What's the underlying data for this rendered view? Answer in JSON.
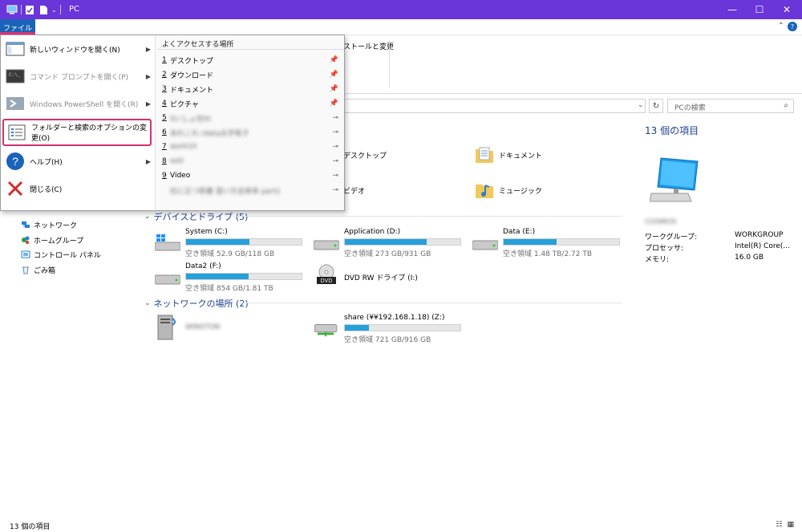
{
  "window": {
    "title": "PC",
    "minimize": "—",
    "maximize": "☐",
    "close": "✕"
  },
  "tabs": {
    "file": "ファイル",
    "help": "?",
    "collapse": "⌃"
  },
  "ribbon": {
    "partial_label": "ストールと変更"
  },
  "address": {
    "search_placeholder": "PCの検索",
    "refresh": "↻",
    "search_icon": "⌕"
  },
  "nav": {
    "items": [
      {
        "label": "ネットワーク",
        "icon": "network-icon"
      },
      {
        "label": "ホームグループ",
        "icon": "homegroup-icon"
      },
      {
        "label": "コントロール パネル",
        "icon": "control-panel-icon"
      },
      {
        "label": "ごみ箱",
        "icon": "recycle-bin-icon"
      }
    ]
  },
  "folders": [
    {
      "label": "デスクトップ",
      "icon": "desktop-folder-icon"
    },
    {
      "label": "ドキュメント",
      "icon": "documents-folder-icon"
    },
    {
      "label": "ビデオ",
      "icon": "videos-folder-icon"
    },
    {
      "label": "ミュージック",
      "icon": "music-folder-icon"
    }
  ],
  "groups": {
    "devices": "デバイスとドライブ (5)",
    "network": "ネットワークの場所 (2)"
  },
  "drives": [
    {
      "name": "System (C:)",
      "free": "空き領域 52.9 GB/118 GB",
      "used_fraction": 0.55
    },
    {
      "name": "Application (D:)",
      "free": "空き領域 273 GB/931 GB",
      "used_fraction": 0.71
    },
    {
      "name": "Data (E:)",
      "free": "空き領域 1.48 TB/2.72 TB",
      "used_fraction": 0.46
    },
    {
      "name": "Data2 (F:)",
      "free": "空き領域 854 GB/1.81 TB",
      "used_fraction": 0.54
    },
    {
      "name": "DVD RW ドライブ (I:)",
      "free": "",
      "used_fraction": 0
    }
  ],
  "network_locations": [
    {
      "name": "WINSTON",
      "free": ""
    },
    {
      "name": "share (¥¥192.168.1.18) (Z:)",
      "free": "空き領域 721 GB/916 GB",
      "used_fraction": 0.21
    }
  ],
  "details": {
    "title": "13 個の項目",
    "computer_name": "COSMOS",
    "props": [
      {
        "key": "ワークグループ:",
        "value": "WORKGROUP"
      },
      {
        "key": "プロセッサ:",
        "value": "Intel(R) Core(..."
      },
      {
        "key": "メモリ:",
        "value": "16.0 GB"
      }
    ]
  },
  "file_menu": {
    "items": [
      {
        "label": "新しいウィンドウを開く(N)",
        "icon": "new-window-icon",
        "arrow": true,
        "disabled": false
      },
      {
        "label": "コマンド プロンプトを開く(P)",
        "icon": "command-prompt-icon",
        "arrow": true,
        "disabled": true
      },
      {
        "label": "Windows PowerShell を開く(R)",
        "icon": "powershell-icon",
        "arrow": true,
        "disabled": true
      },
      {
        "label": "フォルダーと検索のオプションの変更(O)",
        "icon": "folder-options-icon",
        "arrow": false,
        "disabled": false
      },
      {
        "label": "ヘルプ(H)",
        "icon": "help-icon",
        "arrow": true,
        "disabled": false
      },
      {
        "label": "閉じる(C)",
        "icon": "close-icon",
        "arrow": false,
        "disabled": false
      }
    ],
    "frequent_title": "よくアクセスする場所",
    "frequent": [
      {
        "num": "1",
        "label": "デスクトップ",
        "pinned": true
      },
      {
        "num": "2",
        "label": "ダウンロード",
        "pinned": true
      },
      {
        "num": "3",
        "label": "ドキュメント",
        "pinned": true
      },
      {
        "num": "4",
        "label": "ピクチャ",
        "pinned": true
      },
      {
        "num": "5",
        "label": "Sいしょ社ht",
        "pinned": false
      },
      {
        "num": "6",
        "label": "あれこれ rdata太字有子",
        "pinned": false
      },
      {
        "num": "7",
        "label": "work10",
        "pinned": false
      },
      {
        "num": "8",
        "label": "ee0",
        "pinned": false
      },
      {
        "num": "9",
        "label": "Video",
        "pinned": false
      },
      {
        "num": "",
        "label": "社に正つ和書 塗い方全体本 part1",
        "pinned": false
      }
    ],
    "pin_glyph": "📌",
    "unpin_glyph": "⊸"
  },
  "status": {
    "count": "13 個の項目"
  }
}
